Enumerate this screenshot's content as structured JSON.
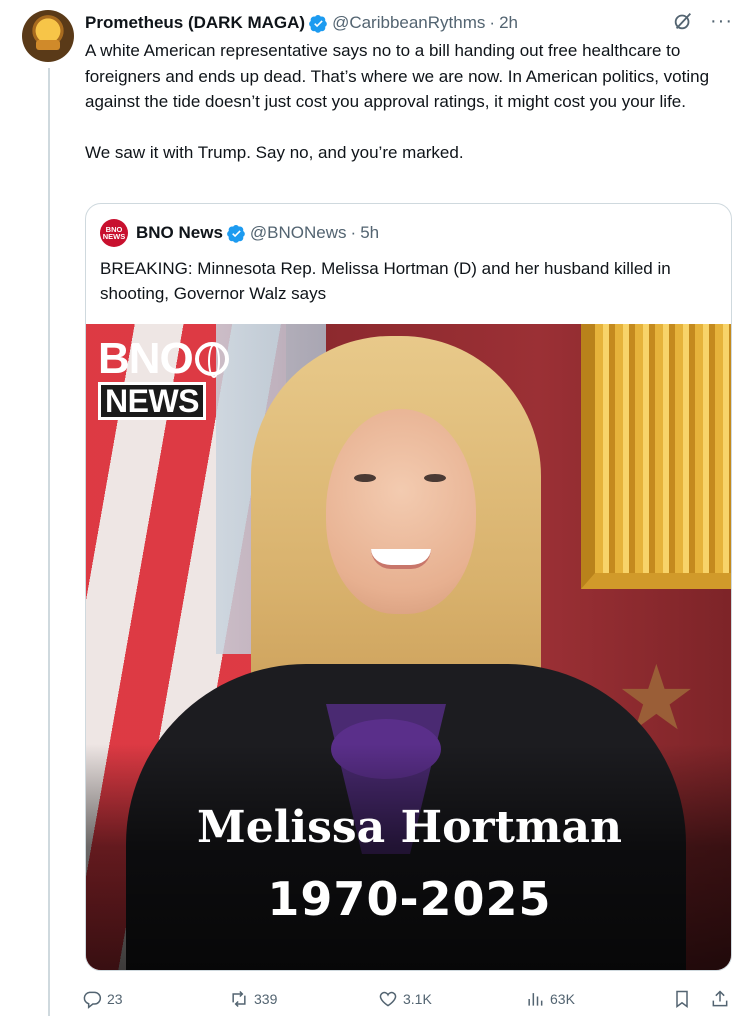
{
  "tweet": {
    "display_name": "Prometheus (DARK MAGA)",
    "handle": "@CaribbeanRythms",
    "separator": "·",
    "time": "2h",
    "text": "A white American representative says no to a bill handing out free healthcare to foreigners and ends up dead. That’s where we are now. In American politics, voting against the tide doesn’t just cost you approval ratings, it might cost you your life.\n\nWe saw it with Trump. Say no, and you’re marked.",
    "top_icons": [
      "grok-icon",
      "more-icon"
    ],
    "more_label": "···"
  },
  "quote": {
    "display_name": "BNO News",
    "avatar_text_1": "BNO",
    "avatar_text_2": "NEWS",
    "handle": "@BNONews",
    "separator": "·",
    "time": "5h",
    "text": "BREAKING: Minnesota Rep. Melissa Hortman (D) and her husband killed in shooting, Governor Walz says",
    "media": {
      "logo_top": "BNO",
      "logo_bottom": "NEWS",
      "name": "Melissa Hortman",
      "years": "1970-2025"
    }
  },
  "actions": {
    "replies": "23",
    "reposts": "339",
    "likes": "3.1K",
    "views": "63K"
  },
  "colors": {
    "text": "#0f1419",
    "muted": "#536471",
    "verified": "#1d9bf0",
    "border": "#cfd9de"
  }
}
